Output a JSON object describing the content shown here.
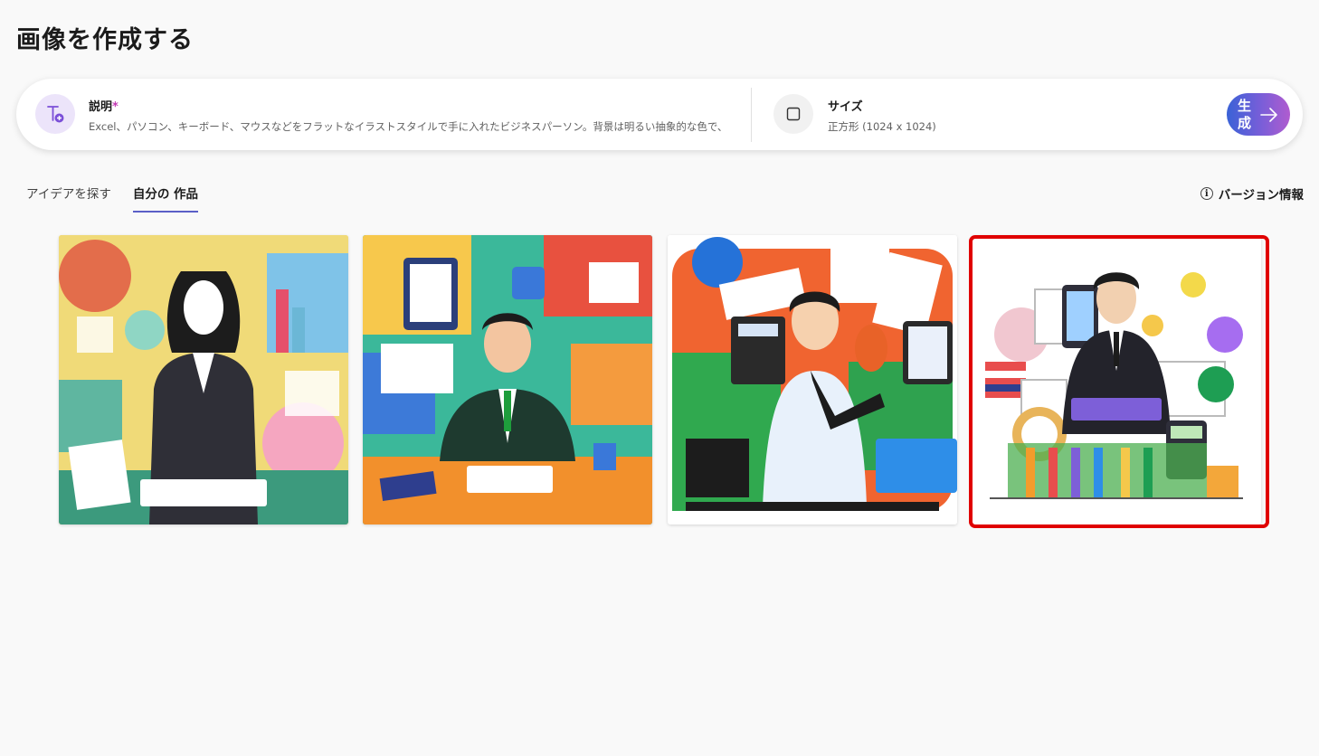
{
  "page": {
    "title": "画像を作成する"
  },
  "prompt": {
    "description_label": "説明",
    "required_mark": "*",
    "description_value": "Excel、パソコン、キーボード、マウスなどをフラットなイラストスタイルで手に入れたビジネスパーソン。背景は明るい抽象的な色で、",
    "size_label": "サイズ",
    "size_value": "正方形 (1024 x 1024)",
    "generate_label": "生成"
  },
  "tabs": [
    {
      "label": "アイデアを探す",
      "active": false
    },
    {
      "label": "自分の 作品",
      "active": true
    }
  ],
  "version_info": {
    "label": "バージョン情報",
    "icon": "info-icon"
  },
  "gallery": {
    "selected_index": 3,
    "highlight_color": "#e00000",
    "images": [
      {
        "icon": "businesswoman-illustration"
      },
      {
        "icon": "businessman-desk-illustration"
      },
      {
        "icon": "excel-man-illustration"
      },
      {
        "icon": "businessman-keyboard-illustration"
      }
    ]
  },
  "colors": {
    "accent": "#5b5fc7",
    "generate_gradient_start": "#3a62d7",
    "generate_gradient_end": "#b05ccf"
  }
}
